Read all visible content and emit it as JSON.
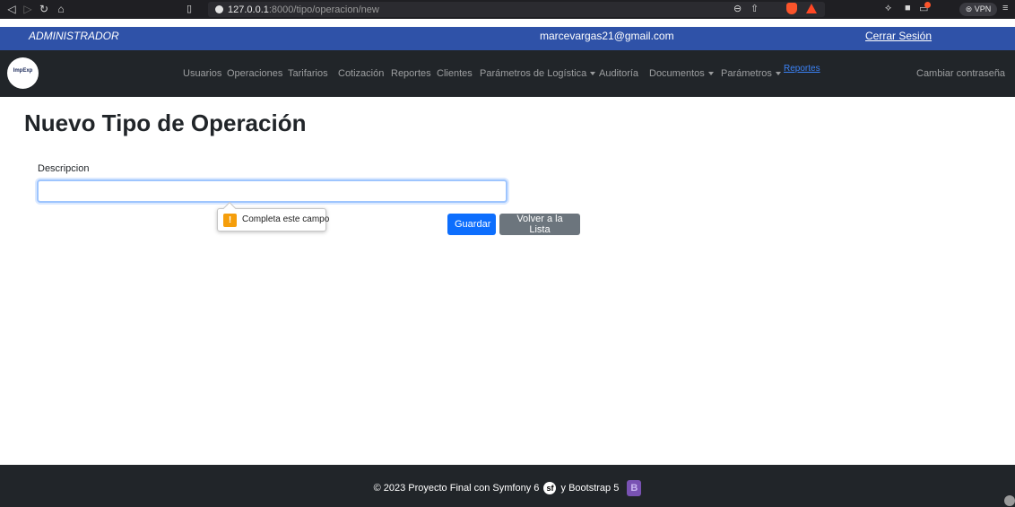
{
  "browser": {
    "url_host": "127.0.0.1",
    "url_rest": ":8000/tipo/operacion/new",
    "vpn_label": "VPN"
  },
  "admin": {
    "role": "ADMINISTRADOR",
    "email": "marcevargas21@gmail.com",
    "logout": "Cerrar Sesión"
  },
  "navbar": {
    "logo_text": "ImpExp",
    "items": [
      {
        "label": "Usuarios"
      },
      {
        "label": "Operaciones"
      },
      {
        "label": "Tarifarios"
      },
      {
        "label": "Cotización"
      },
      {
        "label": "Reportes"
      },
      {
        "label": "Clientes"
      },
      {
        "label": "Parámetros de Logística"
      },
      {
        "label": "Auditoría"
      },
      {
        "label": "Documentos"
      },
      {
        "label": "Parámetros"
      },
      {
        "label": "Reportes"
      }
    ],
    "change_password": "Cambiar contraseña"
  },
  "main": {
    "title": "Nuevo Tipo de Operación",
    "field_label": "Descripcion",
    "field_value": "",
    "validation_message": "Completa este campo",
    "save_label": "Guardar",
    "back_label": "Volver a la Lista"
  },
  "footer": {
    "text_before": "© 2023 Proyecto Final con Symfony 6",
    "text_middle": "y Bootstrap 5"
  },
  "colors": {
    "admin_strip": "#2f52a8",
    "navbar": "#212529",
    "primary": "#0d6efd",
    "secondary": "#6c757d",
    "bootstrap_brand": "#7952b3"
  }
}
